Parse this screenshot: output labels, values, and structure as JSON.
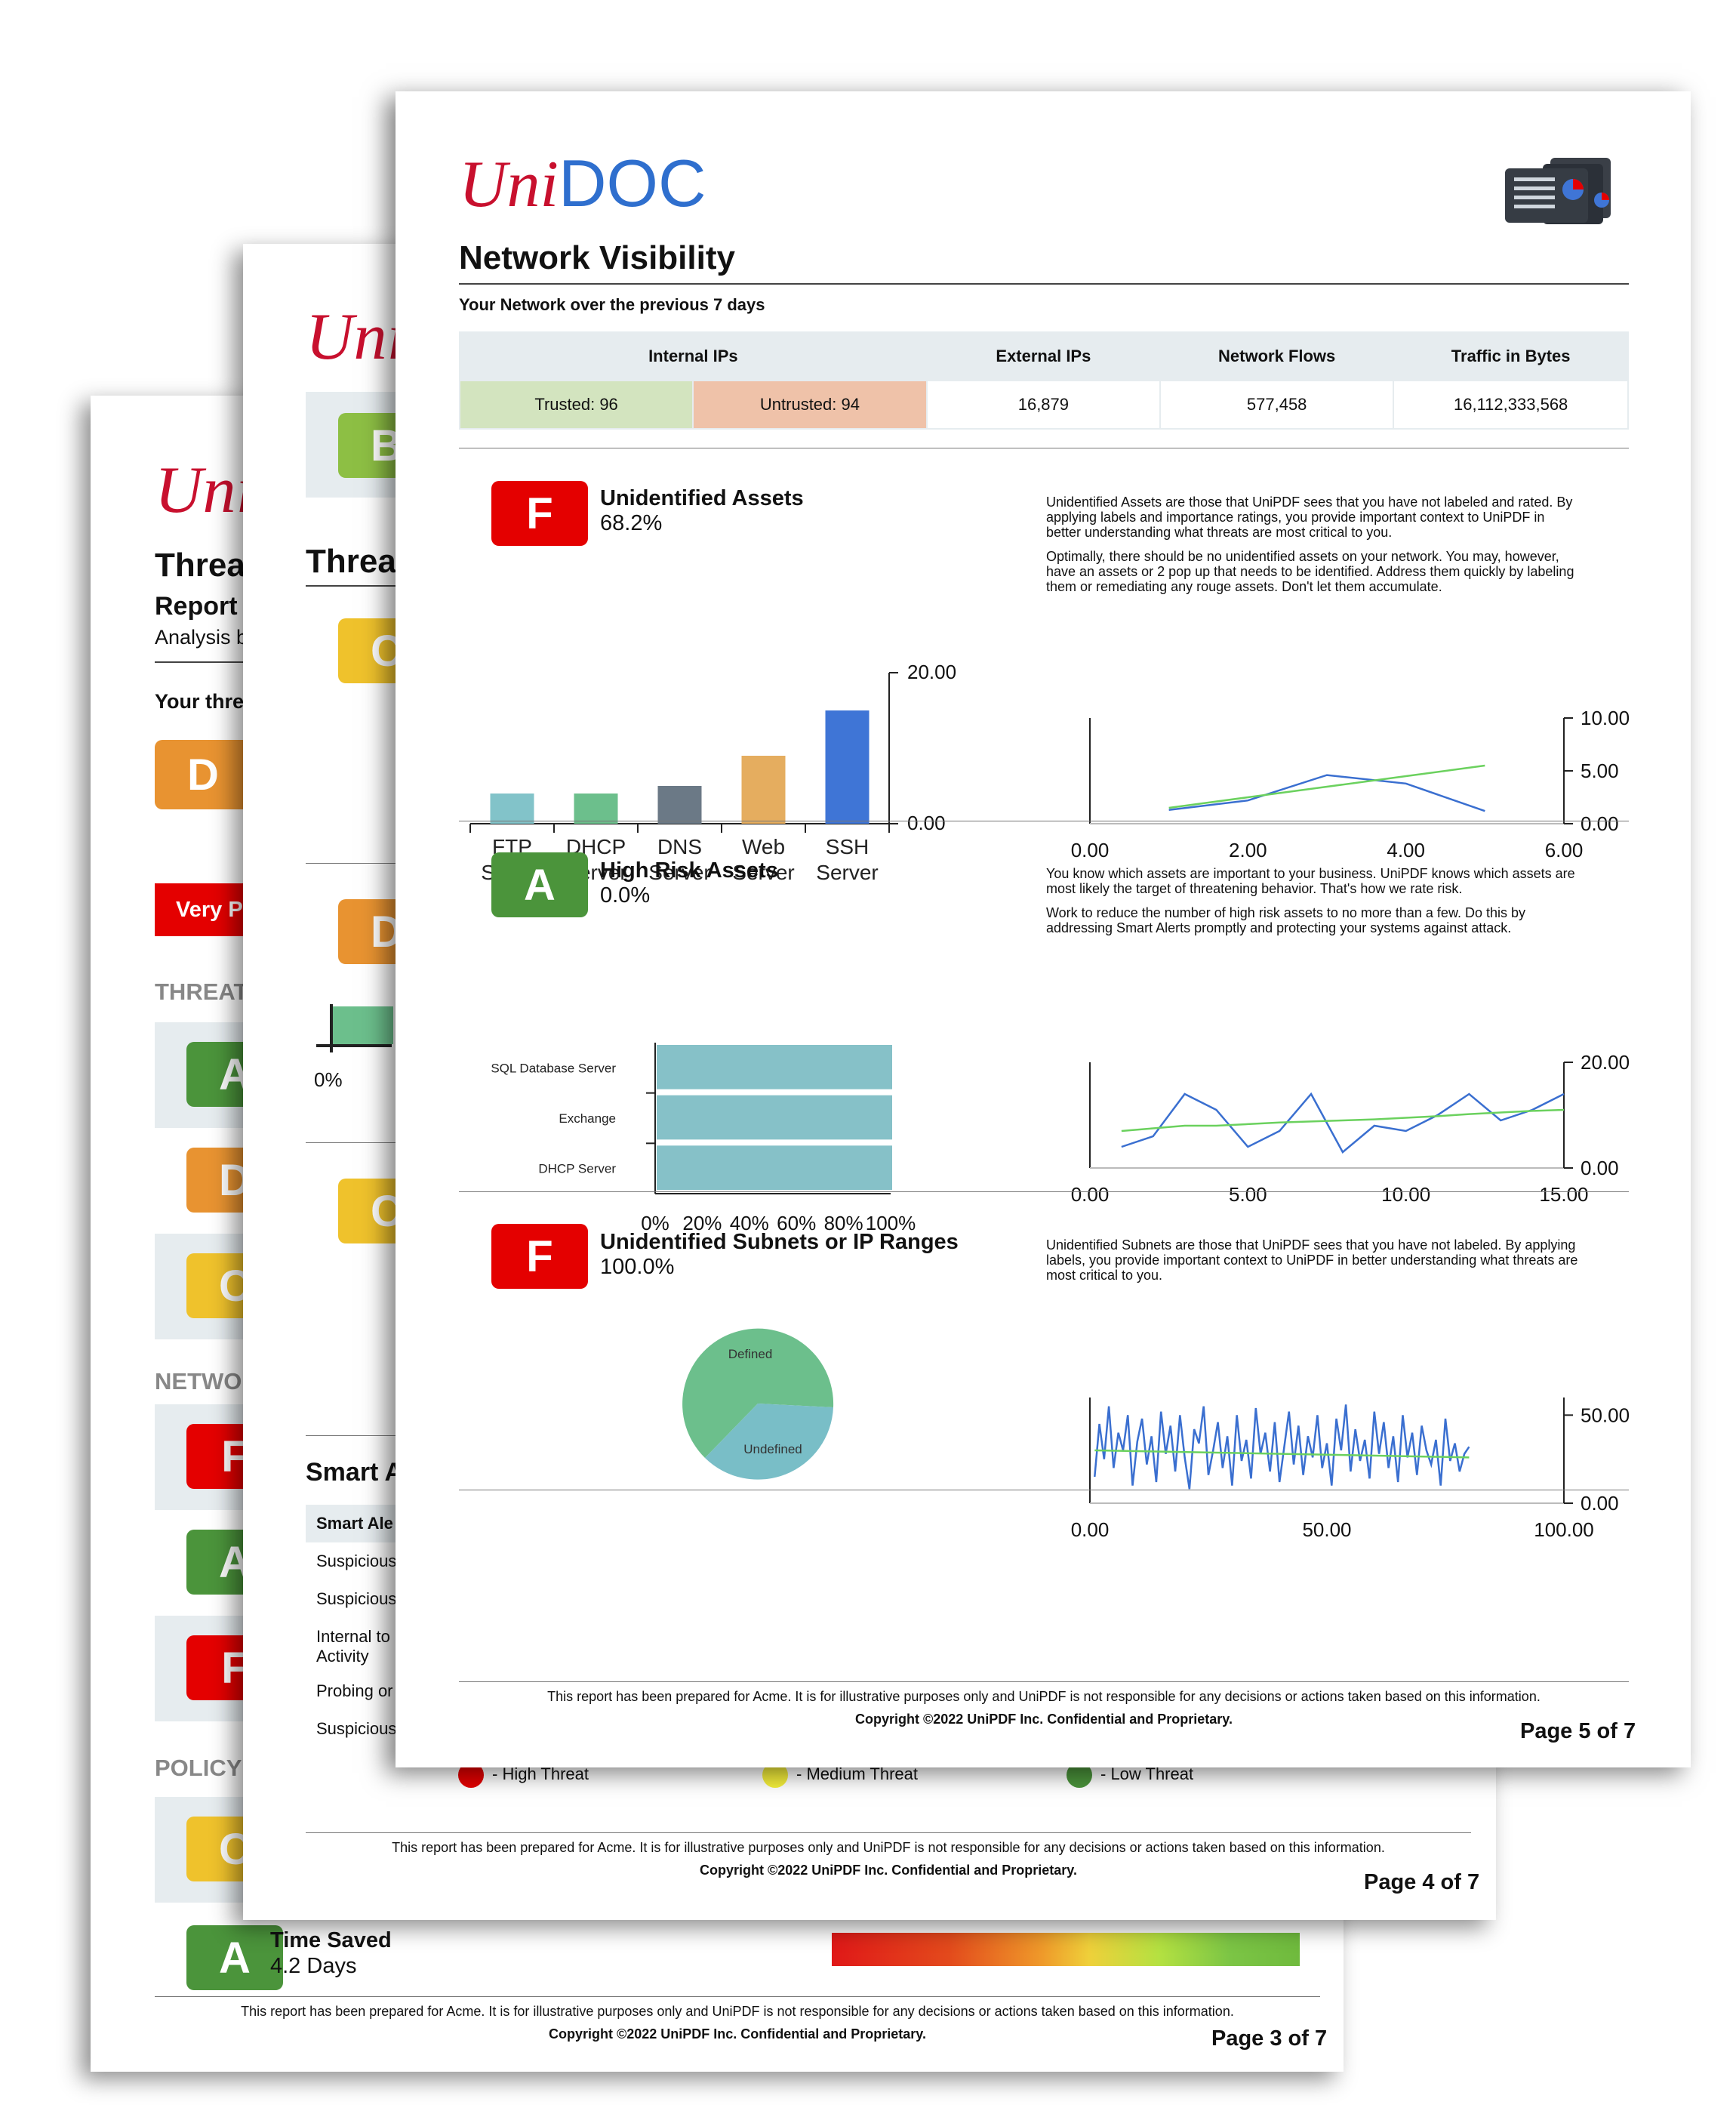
{
  "brand": {
    "uni": "Uni",
    "doc": "DOC"
  },
  "page3": {
    "title": "Threa",
    "report": "Report",
    "analysis": "Analysis b",
    "your_threat": "Your thre",
    "grade_main": "D",
    "banner": "Very Po",
    "section_threat": "THREAT",
    "threat_grades": [
      "A",
      "D",
      "C"
    ],
    "section_network": "NETWO",
    "network_grades": [
      "F",
      "A",
      "F"
    ],
    "section_policy": "POLICY",
    "policy_grades": [
      "C"
    ],
    "time_saved": {
      "grade": "A",
      "title": "Time Saved",
      "value": "4.2 Days"
    },
    "footer": "This report has been prepared for Acme. It is for illustrative purposes only and UniPDF is not responsible for any decisions or actions taken based on this information.",
    "copyright": "Copyright ©2022 UniPDF Inc. Confidential and Proprietary.",
    "page": "Page 3 of 7",
    "colors": {
      "red": "#e40000",
      "green": "#4b943b",
      "orange": "#e89331",
      "yellow": "#efc22c"
    }
  },
  "page4": {
    "title": "Threa",
    "grades": [
      "B",
      "C",
      "D",
      "C"
    ],
    "axis_label": "0%",
    "smart": "Smart A",
    "table_header": "Smart Ale",
    "table_rows": [
      "Suspicious",
      "Suspicious",
      "Internal to",
      "Activity",
      "Probing or",
      "Suspicious"
    ],
    "legend": [
      {
        "label": "- High Threat",
        "color": "#e40000"
      },
      {
        "label": "- Medium Threat",
        "color": "#f5ef3b"
      },
      {
        "label": "- Low Threat",
        "color": "#4b943b"
      }
    ],
    "footer": "This report has been prepared for Acme. It is for illustrative purposes only and UniPDF is not responsible for any decisions or actions taken based on this information.",
    "copyright": "Copyright ©2022 UniPDF Inc. Confidential and Proprietary.",
    "page": "Page 4 of 7"
  },
  "page5": {
    "title": "Network Visibility",
    "subtitle": "Your Network over the previous 7 days",
    "table": {
      "headers": [
        "Internal IPs",
        "External IPs",
        "Network Flows",
        "Traffic in Bytes"
      ],
      "trusted": "Trusted: 96",
      "untrusted": "Untrusted: 94",
      "external": "16,879",
      "flows": "577,458",
      "bytes": "16,112,333,568"
    },
    "sections": [
      {
        "grade": "F",
        "title": "Unidentified Assets",
        "value": "68.2%",
        "desc1": [
          "Unidentified Assets are those that UniPDF sees that you have not labeled and rated. By",
          "applying labels and importance ratings, you provide important context to UniPDF in",
          "better understanding what threats are most critical to you."
        ],
        "desc2": [
          "Optimally, there should be no unidentified assets on your network. You may, however,",
          "have an assets or 2 pop up that needs to be identified. Address them quickly by labeling",
          "them or remediating any rouge assets. Don't let them accumulate."
        ]
      },
      {
        "grade": "A",
        "title": "High Risk Assets",
        "value": "0.0%",
        "desc1": [
          "You know which assets are important to your business. UniPDF knows which assets are",
          "most likely the target of threatening behavior. That's how we rate risk."
        ],
        "desc2": [
          "Work to reduce the number of high risk assets to no more than a few. Do this by",
          "addressing Smart Alerts promptly and protecting your systems against attack."
        ]
      },
      {
        "grade": "F",
        "title": "Unidentified Subnets or IP Ranges",
        "value": "100.0%",
        "desc1": [
          "Unidentified Subnets are those that UniPDF sees that you have not labeled. By applying",
          "labels, you provide important context to UniPDF in better understanding what threats are",
          "most critical to you."
        ],
        "desc2": []
      }
    ],
    "footer": "This report has been prepared for Acme. It is for illustrative purposes only and UniPDF is not responsible for any decisions or actions taken based on this information.",
    "copyright": "Copyright ©2022 UniPDF Inc. Confidential and Proprietary.",
    "page": "Page 5 of 7"
  },
  "chart_data": [
    {
      "type": "bar",
      "categories": [
        "FTP Server",
        "DHCP Server",
        "DNS Server",
        "Web Server",
        "SSH Server"
      ],
      "values": [
        4,
        4,
        5,
        9,
        15
      ],
      "colors": [
        "#82c3c9",
        "#6cbf8c",
        "#6b7986",
        "#e5ad5f",
        "#3f75d6"
      ],
      "yticks": [
        "0.00",
        "20.00"
      ],
      "ylim": [
        0,
        20
      ]
    },
    {
      "type": "line",
      "xticks": [
        "0.00",
        "2.00",
        "4.00",
        "6.00"
      ],
      "yticks": [
        "0.00",
        "5.00",
        "10.00"
      ],
      "xlim": [
        0,
        6
      ],
      "ylim": [
        0,
        10
      ],
      "series": [
        {
          "color": "#3a6fd0",
          "x": [
            1,
            2,
            3,
            4,
            5
          ],
          "y": [
            1.3,
            2.2,
            4.6,
            3.8,
            1.2
          ]
        },
        {
          "color": "#6bd15e",
          "x": [
            1,
            2,
            3,
            4,
            5
          ],
          "y": [
            1.5,
            2.5,
            3.5,
            4.5,
            5.5
          ]
        }
      ]
    },
    {
      "type": "bar",
      "orientation": "horizontal",
      "categories": [
        "SQL Database Server",
        "Exchange",
        "DHCP Server"
      ],
      "values": [
        100,
        100,
        100
      ],
      "color": "#86c1c8",
      "xticks": [
        "0%",
        "20%",
        "40%",
        "60%",
        "80%",
        "100%"
      ],
      "xlim": [
        0,
        100
      ]
    },
    {
      "type": "line",
      "xticks": [
        "0.00",
        "5.00",
        "10.00",
        "15.00"
      ],
      "yticks": [
        "0.00",
        "20.00"
      ],
      "xlim": [
        0,
        15
      ],
      "ylim": [
        0,
        20
      ],
      "series": [
        {
          "color": "#3a6fd0",
          "x": [
            1,
            2,
            3,
            4,
            5,
            6,
            7,
            8,
            9,
            10,
            11,
            12,
            13,
            14,
            15
          ],
          "y": [
            4,
            6,
            14,
            11,
            4,
            7,
            14,
            3,
            8,
            7,
            10,
            14,
            9,
            11,
            14
          ]
        },
        {
          "color": "#6bd15e",
          "x": [
            1,
            2,
            3,
            4,
            5,
            6,
            7,
            8,
            9,
            10,
            11,
            12,
            13,
            14,
            15
          ],
          "y": [
            7,
            7.5,
            8,
            8,
            8.3,
            8.6,
            8.8,
            9,
            9.2,
            9.5,
            9.8,
            10.2,
            10.5,
            10.8,
            11
          ]
        }
      ]
    },
    {
      "type": "pie",
      "labels": [
        "Defined",
        "Undefined"
      ],
      "values": [
        60,
        40
      ],
      "colors": [
        "#6cbf8c",
        "#79bec7"
      ]
    },
    {
      "type": "line",
      "xticks": [
        "0.00",
        "50.00",
        "100.00"
      ],
      "yticks": [
        "0.00",
        "50.00"
      ],
      "xlim": [
        0,
        100
      ],
      "ylim": [
        0,
        60
      ],
      "series": [
        {
          "color": "#3a6fd0",
          "x": [
            1,
            2,
            3,
            4,
            5,
            6,
            7,
            8,
            9,
            10,
            11,
            12,
            13,
            14,
            15,
            16,
            17,
            18,
            19,
            20,
            21,
            22,
            23,
            24,
            25,
            26,
            27,
            28,
            29,
            30,
            31,
            32,
            33,
            34,
            35,
            36,
            37,
            38,
            39,
            40,
            41,
            42,
            43,
            44,
            45,
            46,
            47,
            48,
            49,
            50,
            51,
            52,
            53,
            54,
            55,
            56,
            57,
            58,
            59,
            60,
            61,
            62,
            63,
            64,
            65,
            66,
            67,
            68,
            69,
            70,
            71,
            72,
            73,
            74,
            75,
            76,
            77,
            78,
            79,
            80
          ],
          "y": [
            15,
            45,
            25,
            55,
            20,
            40,
            30,
            50,
            10,
            35,
            48,
            22,
            38,
            12,
            52,
            28,
            44,
            18,
            50,
            26,
            8,
            42,
            34,
            55,
            16,
            30,
            46,
            20,
            38,
            10,
            50,
            24,
            36,
            14,
            54,
            28,
            40,
            18,
            46,
            12,
            32,
            52,
            22,
            44,
            16,
            38,
            26,
            50,
            20,
            34,
            10,
            48,
            30,
            56,
            18,
            42,
            24,
            36,
            14,
            52,
            28,
            46,
            20,
            38,
            12,
            50,
            26,
            40,
            16,
            44,
            30,
            22,
            36,
            10,
            48,
            24,
            34,
            18,
            28,
            32
          ]
        },
        {
          "color": "#6bd15e",
          "x": [
            1,
            80
          ],
          "y": [
            30,
            26
          ]
        }
      ]
    }
  ]
}
